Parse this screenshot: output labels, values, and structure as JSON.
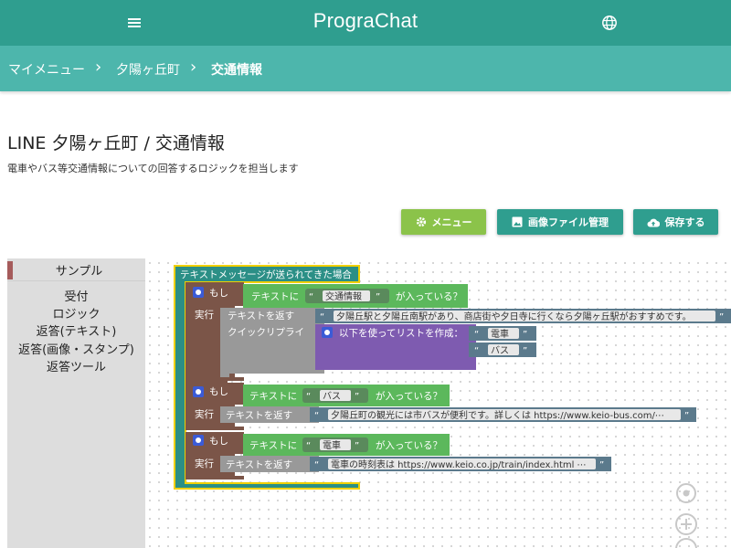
{
  "app": {
    "title": "PrograChat"
  },
  "header": {
    "menu_icon": "hamburger-menu-icon",
    "globe_icon": "globe-icon"
  },
  "breadcrumb": {
    "items": [
      "マイメニュー",
      "夕陽ヶ丘町",
      "交通情報"
    ],
    "separator": "›"
  },
  "page": {
    "title": "LINE 夕陽ヶ丘町 / 交通情報",
    "description": "電車やバス等交通情報についての回答するロジックを担当します"
  },
  "actions": {
    "menu_label": "メニュー",
    "image_label": "画像ファイル管理",
    "save_label": "保存する"
  },
  "toolbox": {
    "sample": "サンプル",
    "categories": [
      "受付",
      "ロジック",
      "返答(テキスト)",
      "返答(画像・スタンプ)",
      "返答ツール"
    ]
  },
  "blocks": {
    "event": "テキストメッセージが送られてきた場合",
    "if_label": "もし",
    "do_label": "実行",
    "text_contains_prefix": "テキストに",
    "text_contains_suffix": "が入っている？",
    "reply_text": "テキストを返す",
    "quick_reply": "クイックリプライ",
    "make_list": "以下を使ってリストを作成：",
    "open_quote": "“",
    "close_quote": "”",
    "rule1": {
      "keyword": "交通情報",
      "reply": "夕陽丘駅と夕陽丘南駅があり、商店街や夕日寺に行くなら夕陽ヶ丘駅がおすすめです。",
      "list_items": [
        "電車",
        "バス"
      ]
    },
    "rule2": {
      "keyword": "バス",
      "reply": "夕陽丘町の観光には市バスが便利です。詳しくは https://www.keio-bus.com/⋯"
    },
    "rule3": {
      "keyword": "電車",
      "reply": "電車の時刻表は https://www.keio.co.jp/train/index.html ⋯"
    }
  },
  "colors": {
    "appbar": "#2f9e8f",
    "crumbbar": "#4db6ac",
    "menu_button": "#8bc34a",
    "event_block": "#2b8f86",
    "if_block": "#7b5548",
    "condition_block": "#5cb85c",
    "reply_block": "#999999",
    "list_block": "#7e5bb0",
    "string_block": "#5b7a8c",
    "highlight": "#f0d000"
  }
}
